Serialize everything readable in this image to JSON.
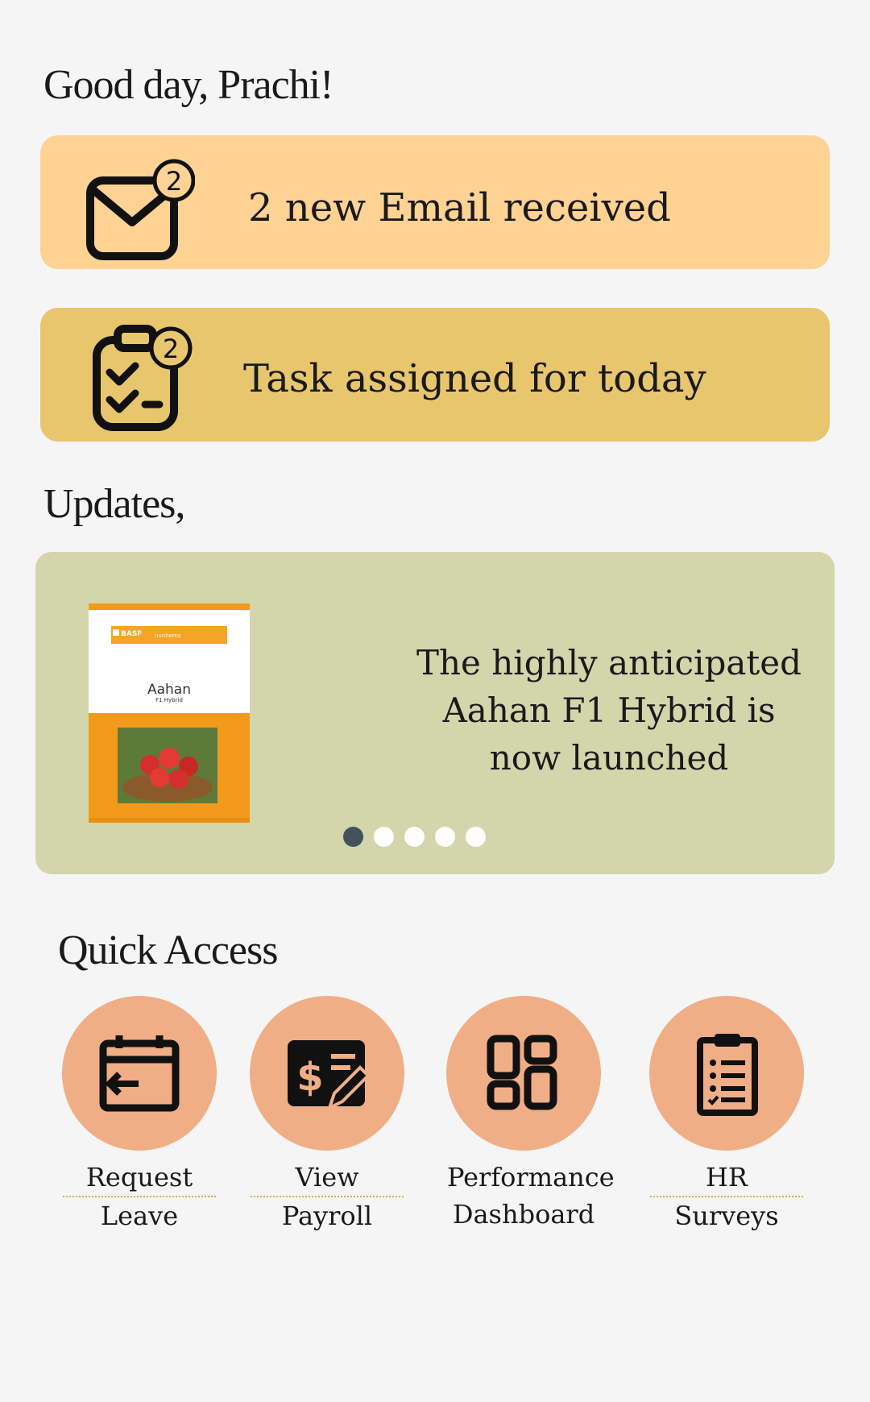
{
  "greeting": "Good day, Prachi!",
  "notifications": [
    {
      "text": "2 new Email received",
      "badge": "2",
      "icon": "mail-icon"
    },
    {
      "text": "Task assigned for today",
      "badge": "2",
      "icon": "clipboard-check-icon"
    }
  ],
  "updates": {
    "title": "Updates,",
    "current_text": "The highly anticipated Aahan F1 Hybrid is now launched",
    "product": {
      "brand": "BASF",
      "sub_brand": "nunhems",
      "name": "Aahan",
      "variant": "F1 Hybrid"
    },
    "pagination": {
      "total": 5,
      "active": 1
    }
  },
  "quick_access": {
    "title": "Quick Access",
    "items": [
      {
        "line1": "Request",
        "line2": "Leave",
        "icon": "calendar-leave-icon"
      },
      {
        "line1": "View",
        "line2": "Payroll",
        "icon": "payroll-icon"
      },
      {
        "line1": "Performance",
        "line2": "Dashboard",
        "icon": "dashboard-icon"
      },
      {
        "line1": "HR",
        "line2": "Surveys",
        "icon": "survey-clipboard-icon"
      }
    ]
  },
  "colors": {
    "background": "#f5f5f5",
    "email_card": "#fdd293",
    "task_card": "#e8c66e",
    "update_card": "#d3d5ab",
    "quick_circle": "#f0ae86",
    "dot_active": "#41525a"
  }
}
